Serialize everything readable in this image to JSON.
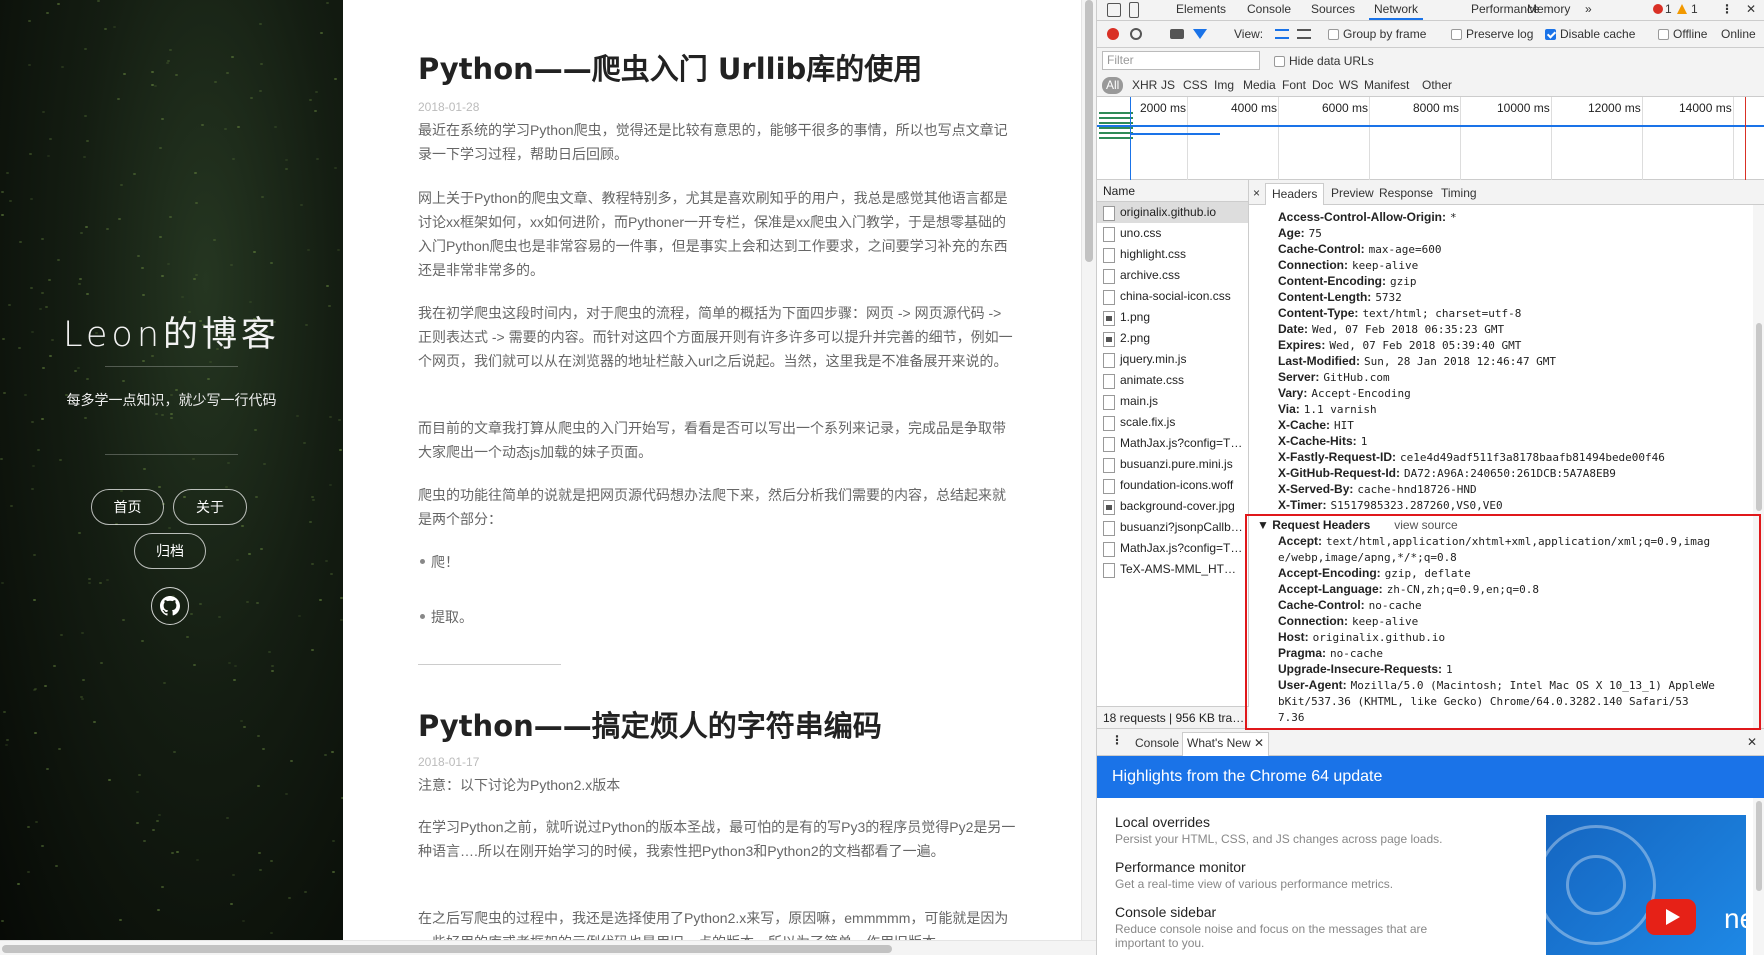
{
  "blog": {
    "title": "Leon的博客",
    "subtitle": "每多学一点知识，就少写一行代码",
    "nav": [
      "首页",
      "关于",
      "归档"
    ]
  },
  "posts": [
    {
      "title": "Python——爬虫入门 Urllib库的使用",
      "date": "2018-01-28",
      "paragraphs": [
        "最近在系统的学习Python爬虫，觉得还是比较有意思的，能够干很多的事情，所以也写点文章记录一下学习过程，帮助日后回顾。",
        "网上关于Python的爬虫文章、教程特别多，尤其是喜欢刷知乎的用户，我总是感觉其他语言都是讨论xx框架如何，xx如何进阶，而Pythoner一开专栏，保准是xx爬虫入门教学，于是想零基础的入门Python爬虫也是非常容易的一件事，但是事实上会和达到工作要求，之间要学习补充的东西还是非常非常多的。",
        "我在初学爬虫这段时间内，对于爬虫的流程，简单的概括为下面四步骤：网页 -> 网页源代码 -> 正则表达式 -> 需要的内容。而针对这四个方面展开则有许多许多可以提升并完善的细节，例如一个网页，我们就可以从在浏览器的地址栏敲入url之后说起。当然，这里我是不准备展开来说的。",
        "而目前的文章我打算从爬虫的入门开始写，看看是否可以写出一个系列来记录，完成品是争取带大家爬出一个动态js加载的妹子页面。",
        "爬虫的功能往简单的说就是把网页源代码想办法爬下来，然后分析我们需要的内容，总结起来就是两个部分："
      ],
      "bullets": [
        "爬！",
        "提取。"
      ]
    },
    {
      "title": "Python——搞定烦人的字符串编码",
      "date": "2018-01-17",
      "paragraphs": [
        "注意：以下讨论为Python2.x版本",
        "在学习Python之前，就听说过Python的版本圣战，最可怕的是有的写Py3的程序员觉得Py2是另一种语言….所以在刚开始学习的时候，我索性把Python3和Python2的文档都看了一遍。",
        "在之后写爬虫的过程中，我还是选择使用了Python2.x来写，原因嘛，emmmmm，可能就是因为一些好用的库或者框架的示例代码也是用旧一点的版本，所以为了简单，作用旧版本"
      ]
    }
  ],
  "devtools": {
    "tabs": [
      "Elements",
      "Console",
      "Sources",
      "Network",
      "Performance",
      "Memory",
      "»"
    ],
    "errors": "1",
    "warnings": "1",
    "toolbar": {
      "view_label": "View:",
      "group_by_frame": "Group by frame",
      "preserve_log": "Preserve log",
      "disable_cache": "Disable cache",
      "offline": "Offline",
      "online": "Online"
    },
    "filter_placeholder": "Filter",
    "hide_data_urls": "Hide data URLs",
    "types": [
      "All",
      "XHR",
      "JS",
      "CSS",
      "Img",
      "Media",
      "Font",
      "Doc",
      "WS",
      "Manifest",
      "Other"
    ],
    "timeline_ticks": [
      "2000 ms",
      "4000 ms",
      "6000 ms",
      "8000 ms",
      "10000 ms",
      "12000 ms",
      "14000 ms"
    ],
    "name_header": "Name",
    "files": [
      "originalix.github.io",
      "uno.css",
      "highlight.css",
      "archive.css",
      "china-social-icon.css",
      "1.png",
      "2.png",
      "jquery.min.js",
      "animate.css",
      "main.js",
      "scale.fix.js",
      "MathJax.js?config=T…",
      "busuanzi.pure.mini.js",
      "foundation-icons.woff",
      "background-cover.jpg",
      "busuanzi?jsonpCallb…",
      "MathJax.js?config=T…",
      "TeX-AMS-MML_HT…"
    ],
    "summary": "18 requests | 956 KB tra…",
    "detail_tabs": [
      "×",
      "Headers",
      "Preview",
      "Response",
      "Timing"
    ],
    "response_headers": [
      [
        "Access-Control-Allow-Origin:",
        "*"
      ],
      [
        "Age:",
        "75"
      ],
      [
        "Cache-Control:",
        "max-age=600"
      ],
      [
        "Connection:",
        "keep-alive"
      ],
      [
        "Content-Encoding:",
        "gzip"
      ],
      [
        "Content-Length:",
        "5732"
      ],
      [
        "Content-Type:",
        "text/html; charset=utf-8"
      ],
      [
        "Date:",
        "Wed, 07 Feb 2018 06:35:23 GMT"
      ],
      [
        "Expires:",
        "Wed, 07 Feb 2018 05:39:40 GMT"
      ],
      [
        "Last-Modified:",
        "Sun, 28 Jan 2018 12:46:47 GMT"
      ],
      [
        "Server:",
        "GitHub.com"
      ],
      [
        "Vary:",
        "Accept-Encoding"
      ],
      [
        "Via:",
        "1.1 varnish"
      ],
      [
        "X-Cache:",
        "HIT"
      ],
      [
        "X-Cache-Hits:",
        "1"
      ],
      [
        "X-Fastly-Request-ID:",
        "ce1e4d49adf511f3a8178baafb81494bede00f46"
      ],
      [
        "X-GitHub-Request-Id:",
        "DA72:A96A:240650:261DCB:5A7A8EB9"
      ],
      [
        "X-Served-By:",
        "cache-hnd18726-HND"
      ],
      [
        "X-Timer:",
        "S1517985323.287260,VS0,VE0"
      ]
    ],
    "request_section": "Request Headers",
    "view_source": "view source",
    "request_headers": [
      [
        "Accept:",
        "text/html,application/xhtml+xml,application/xml;q=0.9,imag",
        "e/webp,image/apng,*/*;q=0.8"
      ],
      [
        "Accept-Encoding:",
        "gzip, deflate"
      ],
      [
        "Accept-Language:",
        "zh-CN,zh;q=0.9,en;q=0.8"
      ],
      [
        "Cache-Control:",
        "no-cache"
      ],
      [
        "Connection:",
        "keep-alive"
      ],
      [
        "Host:",
        "originalix.github.io"
      ],
      [
        "Pragma:",
        "no-cache"
      ],
      [
        "Upgrade-Insecure-Requests:",
        "1"
      ],
      [
        "User-Agent:",
        "Mozilla/5.0 (Macintosh; Intel Mac OS X 10_13_1) AppleWe",
        "bKit/537.36 (KHTML, like Gecko) Chrome/64.0.3282.140 Safari/53",
        "7.36"
      ]
    ],
    "drawer_tabs": [
      "Console",
      "What's New"
    ],
    "banner": "Highlights from the Chrome 64 update",
    "whats_new": [
      {
        "title": "Local overrides",
        "desc": "Persist your HTML, CSS, and JS changes across page loads."
      },
      {
        "title": "Performance monitor",
        "desc": "Get a real-time view of various performance metrics."
      },
      {
        "title": "Console sidebar",
        "desc": "Reduce console noise and focus on the messages that are important to you."
      }
    ],
    "promo_text": "ne",
    "colors": {
      "accent": "#1a73e8",
      "highlight": "#e0181b",
      "error": "#d93025",
      "warning": "#f29900"
    }
  }
}
